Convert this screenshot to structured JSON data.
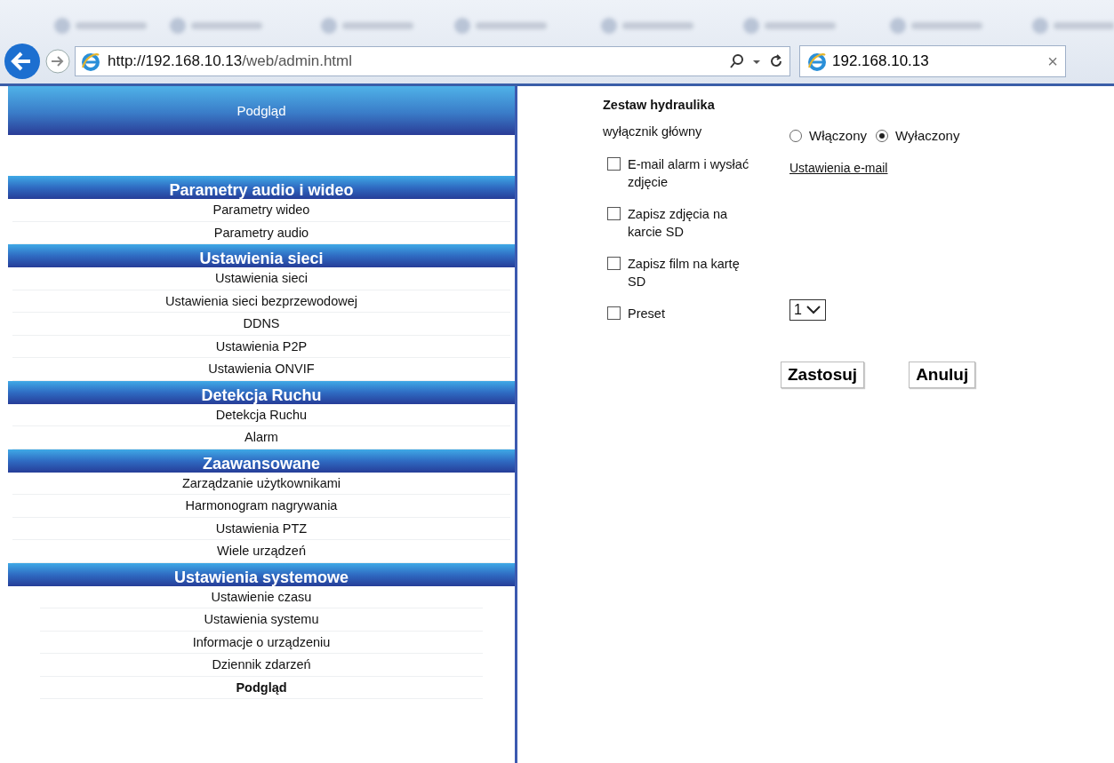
{
  "browser": {
    "url_host": "http://192.168.10.13",
    "url_path": "/web/admin.html",
    "tab_title": "192.168.10.13",
    "tab_close": "×"
  },
  "sidebar": {
    "header": "Podgląd",
    "sections": [
      {
        "title": "Parametry audio i wideo",
        "items": [
          {
            "label": "Parametry wideo",
            "selected": false
          },
          {
            "label": "Parametry audio",
            "selected": false
          }
        ]
      },
      {
        "title": "Ustawienia sieci",
        "items": [
          {
            "label": "Ustawienia sieci",
            "selected": false
          },
          {
            "label": "Ustawienia sieci bezprzewodowej",
            "selected": false
          },
          {
            "label": "DDNS",
            "selected": false
          },
          {
            "label": "Ustawienia P2P",
            "selected": false
          },
          {
            "label": "Ustawienia ONVIF",
            "selected": false
          }
        ]
      },
      {
        "title": "Detekcja Ruchu",
        "items": [
          {
            "label": "Detekcja Ruchu",
            "selected": false
          },
          {
            "label": "Alarm",
            "selected": false
          }
        ]
      },
      {
        "title": "Zaawansowane",
        "items": [
          {
            "label": "Zarządzanie użytkownikami",
            "selected": false
          },
          {
            "label": "Harmonogram nagrywania",
            "selected": false
          },
          {
            "label": "Ustawienia PTZ",
            "selected": false
          },
          {
            "label": "Wiele urządzeń",
            "selected": false
          }
        ]
      },
      {
        "title": "Ustawienia systemowe",
        "items": [
          {
            "label": "Ustawienie czasu",
            "selected": false
          },
          {
            "label": "Ustawienia systemu",
            "selected": false
          },
          {
            "label": "Informacje o urządzeniu",
            "selected": false
          },
          {
            "label": "Dziennik zdarzeń",
            "selected": false
          },
          {
            "label": "Podgląd",
            "selected": true
          }
        ]
      }
    ]
  },
  "form": {
    "title": "Zestaw hydraulika",
    "main_switch": {
      "label": "wyłącznik główny",
      "options": [
        {
          "label": "Włączony",
          "selected": false
        },
        {
          "label": "Wyłaczony",
          "selected": true
        }
      ]
    },
    "options": [
      {
        "label": "E-mail alarm i wysłać zdjęcie",
        "checked": false,
        "link": "Ustawienia e-mail"
      },
      {
        "label": "Zapisz zdjęcia na karcie SD",
        "checked": false
      },
      {
        "label": "Zapisz film na kartę SD",
        "checked": false
      },
      {
        "label": "Preset",
        "checked": false,
        "select": "1"
      }
    ],
    "buttons": [
      "Zastosuj",
      "Anuluj"
    ]
  }
}
